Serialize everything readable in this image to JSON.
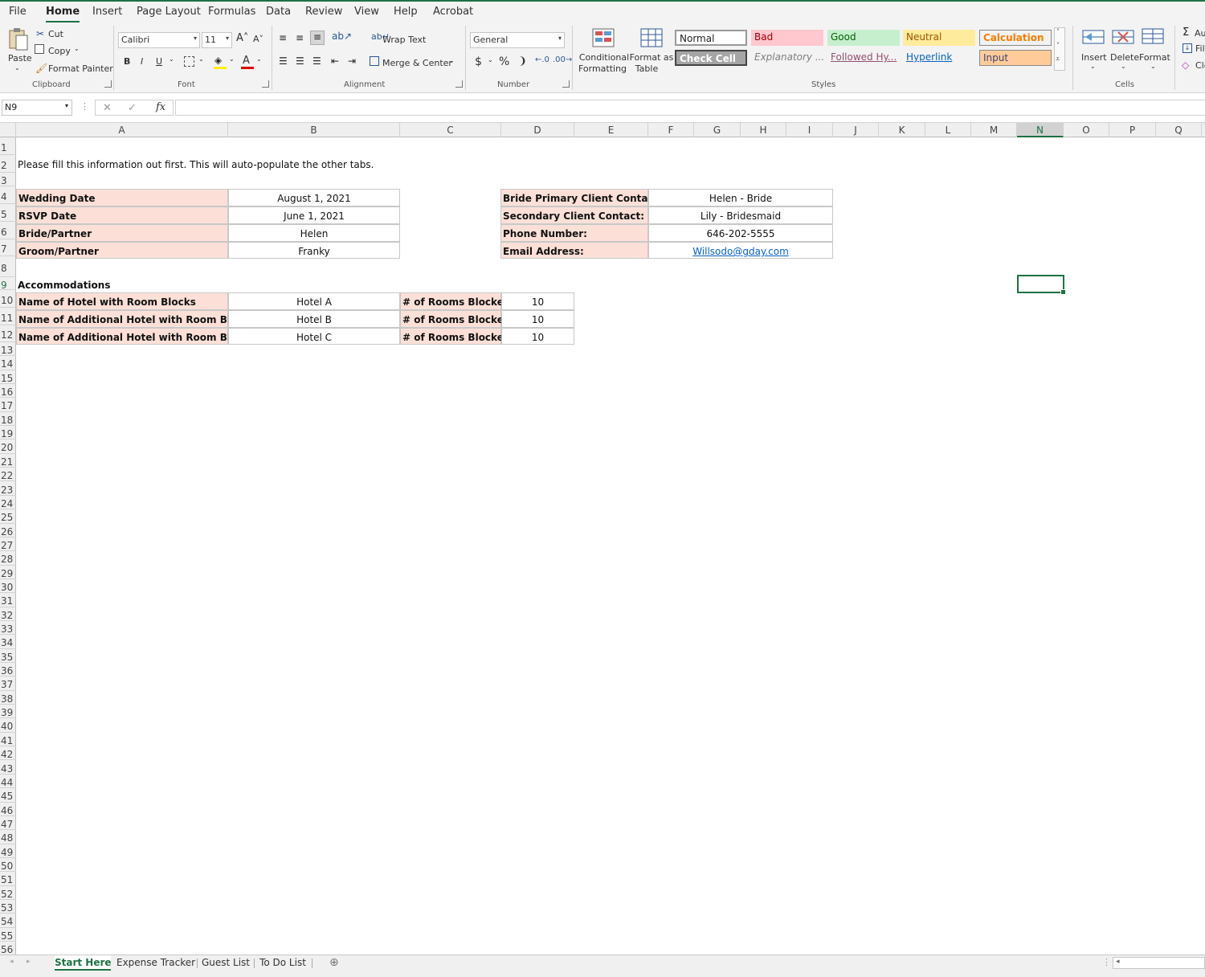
{
  "ribbon_tabs": [
    "File",
    "Home",
    "Insert",
    "Page Layout",
    "Formulas",
    "Data",
    "Review",
    "View",
    "Help",
    "Acrobat"
  ],
  "clipboard": {
    "paste": "Paste",
    "cut": "Cut",
    "copy": "Copy",
    "format_painter": "Format Painter",
    "group": "Clipboard"
  },
  "font": {
    "name": "Calibri",
    "size": "11",
    "group": "Font",
    "bold": "B",
    "italic": "I",
    "underline": "U"
  },
  "alignment": {
    "wrap_text": "Wrap Text",
    "merge_center": "Merge & Center",
    "group": "Alignment"
  },
  "number": {
    "format": "General",
    "currency": "$",
    "percent": "%",
    "comma": "❩",
    "group": "Number"
  },
  "styles": {
    "conditional_formatting": "Conditional",
    "conditional_formatting2": "Formatting",
    "format_as_table": "Format as",
    "format_as_table2": "Table",
    "group": "Styles",
    "gallery": [
      {
        "name": "Normal",
        "bg": "#ffffff",
        "fg": "#222222"
      },
      {
        "name": "Bad",
        "bg": "#ffc7ce",
        "fg": "#9c0006"
      },
      {
        "name": "Good",
        "bg": "#c6efce",
        "fg": "#006100"
      },
      {
        "name": "Neutral",
        "bg": "#ffeb9c",
        "fg": "#9c5700"
      },
      {
        "name": "Calculation",
        "bg": "#f2f2f2",
        "fg": "#fa7d00"
      },
      {
        "name": "Check Cell",
        "bg": "#a5a5a5",
        "fg": "#ffffff"
      },
      {
        "name": "Explanatory ...",
        "bg": "#f3f3f3",
        "fg": "#7f7f7f"
      },
      {
        "name": "Followed Hy...",
        "bg": "#f3f3f3",
        "fg": "#954f72"
      },
      {
        "name": "Hyperlink",
        "bg": "#f3f3f3",
        "fg": "#0563c1"
      },
      {
        "name": "Input",
        "bg": "#ffcc99",
        "fg": "#3f3f76"
      }
    ]
  },
  "cells_group": {
    "insert": "Insert",
    "delete": "Delete",
    "format": "Format",
    "group": "Cells"
  },
  "editing": {
    "autosum": "Au",
    "fill": "Fill",
    "clear": "Cle"
  },
  "formula_bar": {
    "name_box": "N9",
    "fx": "fx",
    "value": ""
  },
  "columns": [
    "A",
    "B",
    "C",
    "D",
    "E",
    "F",
    "G",
    "H",
    "I",
    "J",
    "K",
    "L",
    "M",
    "N",
    "O",
    "P",
    "Q"
  ],
  "selected_column": "N",
  "selected_row": "9",
  "rows_count": 56,
  "sheet": {
    "instructions": "Please fill this information out first. This will auto-populate the other tabs.",
    "event": [
      {
        "label": "Wedding Date",
        "value": "August 1, 2021"
      },
      {
        "label": "RSVP Date",
        "value": "June 1, 2021"
      },
      {
        "label": "Bride/Partner",
        "value": "Helen"
      },
      {
        "label": "Groom/Partner",
        "value": "Franky"
      }
    ],
    "contact": [
      {
        "label": "Bride Primary Client Contact:",
        "value": "Helen - Bride"
      },
      {
        "label": "Secondary Client Contact:",
        "value": "Lily - Bridesmaid"
      },
      {
        "label": "Phone Number:",
        "value": "646-202-5555"
      },
      {
        "label": "Email Address:",
        "value": "Willsodo@gday.com"
      }
    ],
    "accommodations_title": "Accommodations",
    "hotels": [
      {
        "label": "Name of Hotel with Room Blocks",
        "hotel": "Hotel A",
        "rooms_label": "# of Rooms Blocked",
        "rooms": "10"
      },
      {
        "label": "Name of Additional Hotel with Room Blocks",
        "hotel": "Hotel B",
        "rooms_label": "# of Rooms Blocked",
        "rooms": "10"
      },
      {
        "label": "Name of Additional Hotel with Room Blocks",
        "hotel": "Hotel C",
        "rooms_label": "# of Rooms Blocked",
        "rooms": "10"
      }
    ]
  },
  "sheet_tabs": [
    {
      "name": "Start Here",
      "active": true
    },
    {
      "name": "Expense Tracker",
      "active": false
    },
    {
      "name": "Guest List",
      "active": false
    },
    {
      "name": "To Do List",
      "active": false
    }
  ],
  "add_sheet": "⊕"
}
